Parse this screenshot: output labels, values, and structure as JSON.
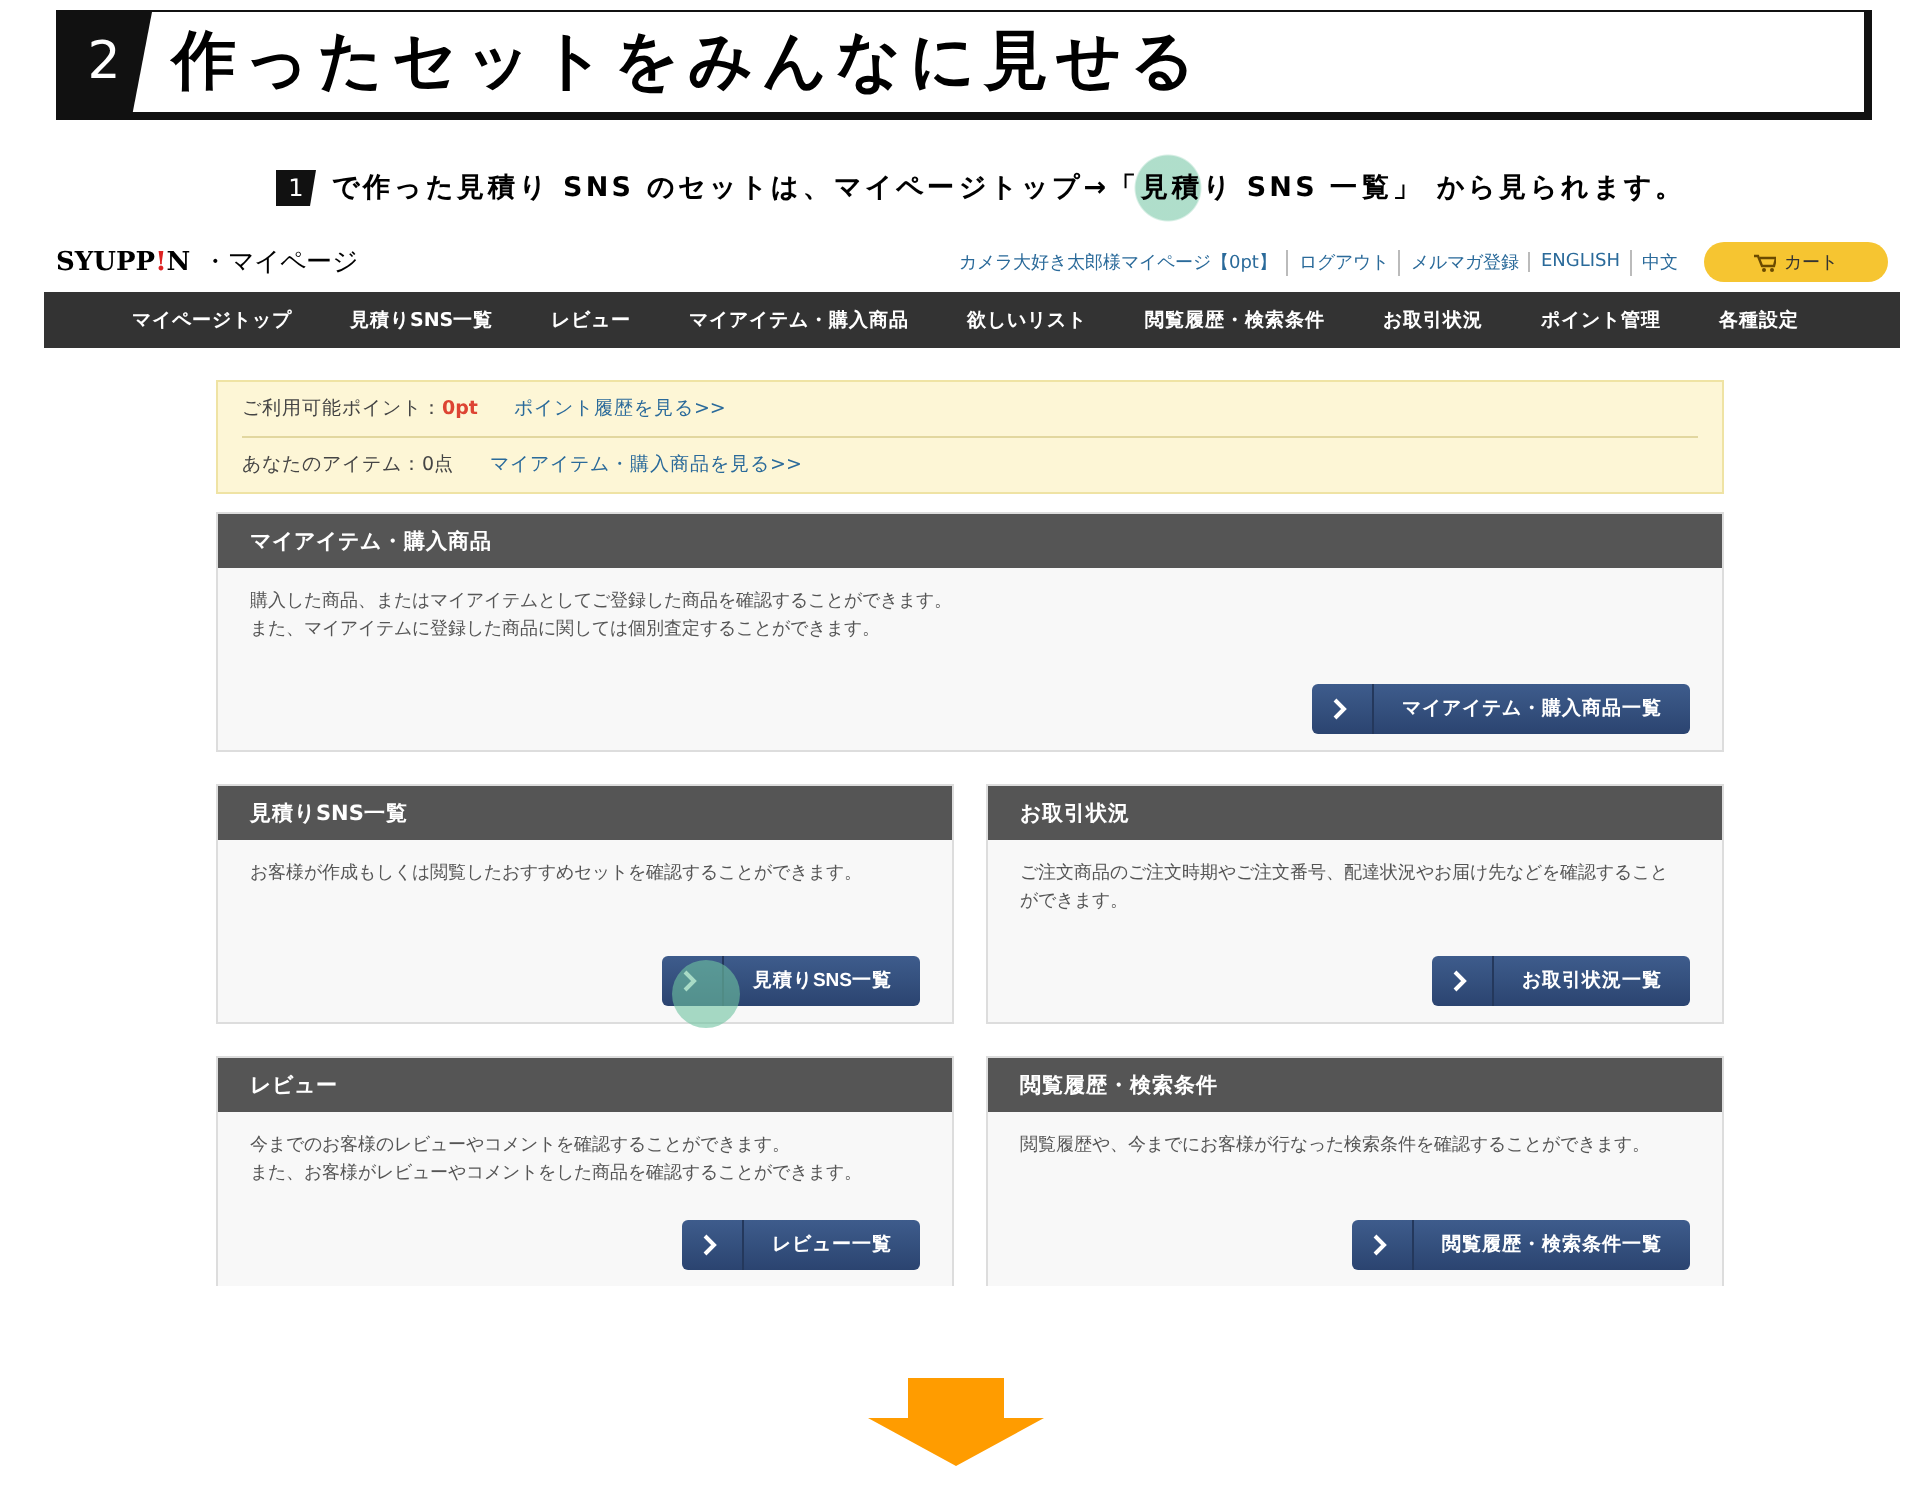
{
  "step": {
    "number": "2",
    "title": "作ったセットをみんなに見せる"
  },
  "note": {
    "number": "1",
    "text": "で作った見積り SNS のセットは、マイページトップ→「見積り SNS 一覧」 から見られます。"
  },
  "site": {
    "logo": "SYUPP",
    "logo_mark": "!",
    "logo_end": "N",
    "logo_suffix": "・マイページ",
    "header_links": [
      "カメラ大好き太郎様マイページ【0pt】",
      "ログアウト",
      "メルマガ登録",
      "ENGLISH",
      "中文"
    ],
    "cart_button": "カート",
    "nav": [
      "マイページトップ",
      "見積りSNS一覧",
      "レビュー",
      "マイアイテム・購入商品",
      "欲しいリスト",
      "閲覧履歴・検索条件",
      "お取引状況",
      "ポイント管理",
      "各種設定"
    ],
    "info": [
      {
        "label": "ご利用可能ポイント：",
        "value": "0pt",
        "kind": "points",
        "link": "ポイント履歴を見る>>"
      },
      {
        "label": "あなたのアイテム：",
        "value": "0点",
        "kind": "count",
        "link": "マイアイテム・購入商品を見る>>"
      }
    ],
    "sections": [
      {
        "title": "マイアイテム・購入商品",
        "body": [
          "購入した商品、またはマイアイテムとしてご登録した商品を確認することができます。",
          "また、マイアイテムに登録した商品に関しては個別査定することができます。"
        ],
        "button": "マイアイテム・購入商品一覧",
        "highlighted": false,
        "wide": true
      },
      {
        "title": "見積りSNS一覧",
        "body": [
          "お客様が作成もしくは閲覧したおすすめセットを確認することができます。"
        ],
        "button": "見積りSNS一覧",
        "highlighted": true,
        "wide": false
      },
      {
        "title": "お取引状況",
        "body": [
          "ご注文商品のご注文時期やご注文番号、配達状況やお届け先などを確認すること",
          "ができます。"
        ],
        "button": "お取引状況一覧",
        "highlighted": false,
        "wide": false
      },
      {
        "title": "レビュー",
        "body": [
          "今までのお客様のレビューやコメントを確認することができます。",
          "また、お客様がレビューやコメントをした商品を確認することができます。"
        ],
        "button": "レビュー一覧",
        "highlighted": false,
        "wide": false
      },
      {
        "title": "閲覧履歴・検索条件",
        "body": [
          "閲覧履歴や、今までにお客様が行なった検索条件を確認することができます。"
        ],
        "button": "閲覧履歴・検索条件一覧",
        "highlighted": false,
        "wide": false
      }
    ]
  }
}
